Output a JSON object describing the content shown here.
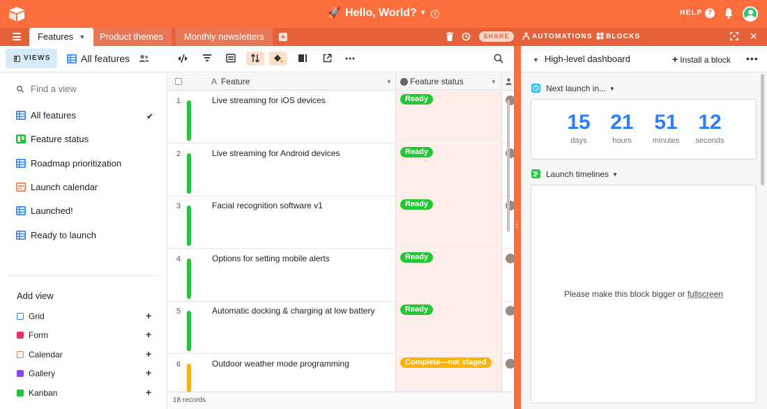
{
  "topbar": {
    "base_title": "Hello, World?",
    "help_label": "HELP"
  },
  "tabs": [
    {
      "label": "Features",
      "active": true
    },
    {
      "label": "Product themes",
      "active": false
    },
    {
      "label": "Monthly newsletters",
      "active": false
    }
  ],
  "tabbar": {
    "share_label": "SHARE",
    "automations_label": "AUTOMATIONS",
    "blocks_label": "BLOCKS"
  },
  "viewbar": {
    "views_label": "VIEWS",
    "current_view": "All features"
  },
  "sidebar": {
    "find_placeholder": "Find a view",
    "views": [
      {
        "label": "All features",
        "icon": "grid-icon",
        "color": "#2d7ff9",
        "selected": true
      },
      {
        "label": "Feature status",
        "icon": "kanban-icon",
        "color": "#20c933",
        "selected": false
      },
      {
        "label": "Roadmap prioritization",
        "icon": "grid-icon",
        "color": "#2d7ff9",
        "selected": false
      },
      {
        "label": "Launch calendar",
        "icon": "calendar-icon",
        "color": "#fc6e3c",
        "selected": false
      },
      {
        "label": "Launched!",
        "icon": "grid-icon",
        "color": "#2d7ff9",
        "selected": false
      },
      {
        "label": "Ready to launch",
        "icon": "grid-icon",
        "color": "#2d7ff9",
        "selected": false
      }
    ],
    "add_view_label": "Add view",
    "add_views": [
      {
        "label": "Grid",
        "color": "#2d7ff9"
      },
      {
        "label": "Form",
        "color": "#f82b60"
      },
      {
        "label": "Calendar",
        "color": "#fc6e3c"
      },
      {
        "label": "Gallery",
        "color": "#8b46ff"
      },
      {
        "label": "Kanban",
        "color": "#20c933"
      }
    ]
  },
  "grid": {
    "columns": {
      "feature": "Feature",
      "status": "Feature status"
    },
    "rows": [
      {
        "num": "1",
        "feature": "Live streaming for iOS devices",
        "status": "Ready",
        "status_color": "#20c933",
        "bar_color": "#20c933"
      },
      {
        "num": "2",
        "feature": "Live streaming for Android devices",
        "status": "Ready",
        "status_color": "#20c933",
        "bar_color": "#20c933"
      },
      {
        "num": "3",
        "feature": "Facial recognition software v1",
        "status": "Ready",
        "status_color": "#20c933",
        "bar_color": "#20c933"
      },
      {
        "num": "4",
        "feature": "Options for setting mobile alerts",
        "status": "Ready",
        "status_color": "#20c933",
        "bar_color": "#20c933"
      },
      {
        "num": "5",
        "feature": "Automatic docking & charging at low battery",
        "status": "Ready",
        "status_color": "#20c933",
        "bar_color": "#20c933"
      },
      {
        "num": "6",
        "feature": "Outdoor weather mode programming",
        "status": "Complete—not staged",
        "status_color": "#fcb400",
        "bar_color": "#fcb400"
      }
    ],
    "records_label": "18 records"
  },
  "dashboard": {
    "title": "High-level dashboard",
    "install_label": "Install a block",
    "countdown_label": "Next launch in...",
    "countdown": [
      {
        "value": "15",
        "unit": "days"
      },
      {
        "value": "21",
        "unit": "hours"
      },
      {
        "value": "51",
        "unit": "minutes"
      },
      {
        "value": "12",
        "unit": "seconds"
      }
    ],
    "timeline_label": "Launch timelines",
    "timeline_msg_prefix": "Please make this block bigger or ",
    "timeline_msg_link": "fullscreen"
  },
  "colors": {
    "brand_orange": "#fc6e3c",
    "accent_blue": "#2d7ff9",
    "ready_green": "#20c933",
    "staged_yellow": "#fcb400"
  }
}
